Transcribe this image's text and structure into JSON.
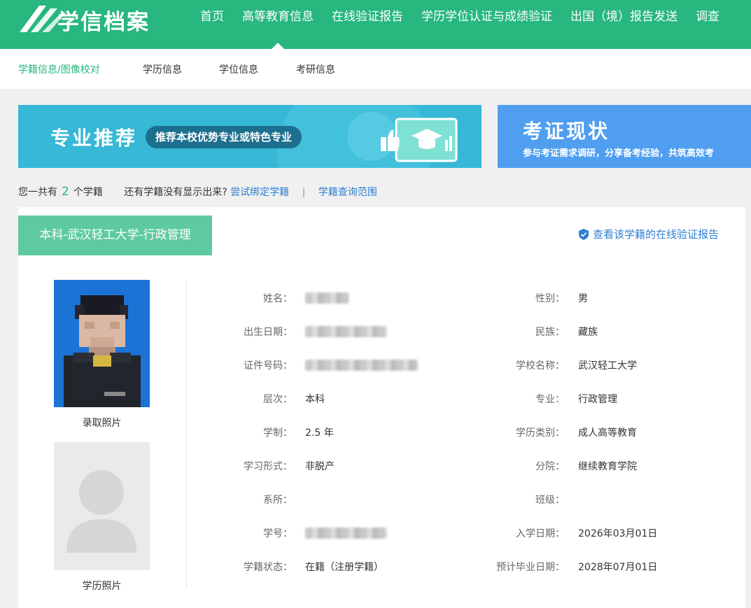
{
  "header": {
    "logo_text": "学信档案",
    "nav": [
      "首页",
      "高等教育信息",
      "在线验证报告",
      "学历学位认证与成绩验证",
      "出国（境）报告发送",
      "调查"
    ],
    "active_nav": 1
  },
  "subnav": {
    "items": [
      "学籍信息/图像校对",
      "学历信息",
      "学位信息",
      "考研信息"
    ],
    "active": 0
  },
  "banners": {
    "left_title": "专业推荐",
    "left_pill": "推荐本校优势专业或特色专业",
    "right_title": "考证现状",
    "right_sub": "参与考证需求调研，分享备考经验，共筑高效考"
  },
  "summary": {
    "prefix": "您一共有",
    "count": "2",
    "suffix": "个学籍",
    "question": "还有学籍没有显示出来?",
    "bind_link": "尝试绑定学籍",
    "separator": "|",
    "range_link": "学籍查询范围"
  },
  "record": {
    "tab_label": "本科-武汉轻工大学-行政管理",
    "verify_link": "查看该学籍的在线验证报告",
    "photo1_caption": "录取照片",
    "photo2_caption": "学历照片",
    "left_fields": [
      {
        "label": "姓名：",
        "value": "",
        "blurred": true
      },
      {
        "label": "出生日期：",
        "value": "",
        "blurred": true
      },
      {
        "label": "证件号码：",
        "value": "",
        "blurred": true
      },
      {
        "label": "层次：",
        "value": "本科"
      },
      {
        "label": "学制：",
        "value": "2.5 年"
      },
      {
        "label": "学习形式：",
        "value": "非脱产"
      },
      {
        "label": "系所：",
        "value": ""
      },
      {
        "label": "学号：",
        "value": "",
        "blurred": true
      },
      {
        "label": "学籍状态：",
        "value": "在籍（注册学籍）"
      }
    ],
    "right_fields": [
      {
        "label": "性别：",
        "value": "男"
      },
      {
        "label": "民族：",
        "value": "藏族"
      },
      {
        "label": "学校名称：",
        "value": "武汉轻工大学"
      },
      {
        "label": "专业：",
        "value": "行政管理"
      },
      {
        "label": "学历类别：",
        "value": "成人高等教育"
      },
      {
        "label": "分院：",
        "value": "继续教育学院"
      },
      {
        "label": "班级：",
        "value": ""
      },
      {
        "label": "入学日期：",
        "value": "2026年03月01日"
      },
      {
        "label": "预计毕业日期：",
        "value": "2028年07月01日"
      }
    ]
  },
  "colors": {
    "brand_green": "#27b77f",
    "tab_green": "#5fcaa2",
    "link_blue": "#2f7fd0"
  }
}
